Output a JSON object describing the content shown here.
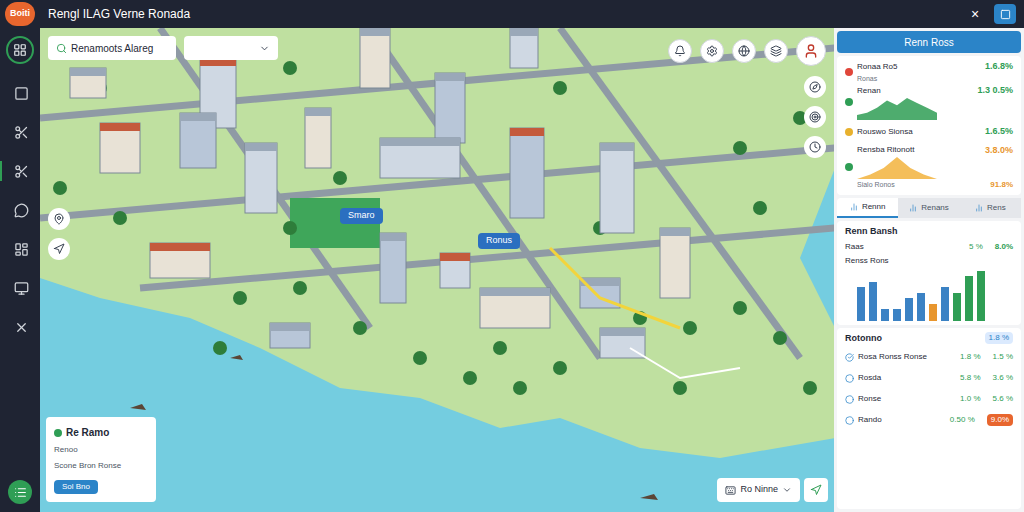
{
  "app": {
    "logo": "Boiti",
    "title": "Rengl ILAG Verne Ronada",
    "close": "×"
  },
  "sidebar": {
    "items": [
      {
        "selected": false
      },
      {
        "selected": false
      },
      {
        "selected": true
      },
      {
        "selected": false
      },
      {
        "selected": false
      },
      {
        "selected": false
      },
      {
        "selected": false
      }
    ]
  },
  "map": {
    "search": "Renamoots Alareg",
    "labels": [
      {
        "text": "Smaro"
      },
      {
        "text": "Ronus"
      }
    ],
    "info_card": {
      "title": "Re Ramo",
      "lines": [
        "Renoo",
        "Scone Bron Ronse"
      ],
      "button": "Sol Bno"
    },
    "toolbar": {
      "label": "Ro Ninne"
    }
  },
  "panel": {
    "header": "Renn Ross",
    "metrics": [
      {
        "name": "Ronaa Ro5",
        "sub": "Ronas",
        "value": "1.6.8%",
        "color": "#e0463a",
        "alert": false
      },
      {
        "name": "Renan",
        "sub": "",
        "value": "1.3 0.5%",
        "color": "#2f9e55",
        "alert": false,
        "chart": {
          "kind": "area",
          "values": [
            2,
            3,
            5,
            8,
            6,
            9,
            7,
            5,
            3
          ]
        }
      },
      {
        "name": "Rouswo Sionsa",
        "sub": "",
        "value": "1.6.5%",
        "color": "#e8b12e",
        "alert": false
      },
      {
        "name": "Rensba Ritonott",
        "sub": "Sialo Ronos",
        "value": "3.8.0%",
        "sub_value": "91.8%",
        "color": "#2f9e55",
        "alert": true,
        "chart": {
          "kind": "peak",
          "values": [
            0,
            2,
            5,
            10,
            5,
            2,
            0
          ]
        }
      }
    ],
    "tabs": [
      {
        "label": "Rennn",
        "selected": true
      },
      {
        "label": "Renans",
        "selected": false
      },
      {
        "label": "Rens",
        "selected": false
      }
    ],
    "section": {
      "title": "Renn Bansh",
      "rows": [
        {
          "label": "Raas",
          "a": "5 %",
          "b": "8.0%"
        }
      ],
      "chart": {
        "title": "Renss Rons",
        "values": [
          6,
          7,
          2,
          2,
          4,
          5,
          3,
          6,
          5,
          8,
          9
        ],
        "colors": [
          "#3b82c4",
          "#3b82c4",
          "#3b82c4",
          "#3b82c4",
          "#3b82c4",
          "#3b82c4",
          "#e8962e",
          "#3b82c4",
          "#2f9e55",
          "#2f9e55",
          "#2f9e55"
        ]
      }
    },
    "list": {
      "title": "Rotonno",
      "badge": "1.8 %",
      "rows": [
        {
          "label": "Rosa Ronss Ronse",
          "a": "1.8 %",
          "b": "1.5 %",
          "highlight": false
        },
        {
          "label": "Rosda",
          "a": "5.8 %",
          "b": "3.6 %",
          "highlight": false
        },
        {
          "label": "Ronse",
          "a": "1.0 %",
          "b": "5.6 %",
          "highlight": false
        },
        {
          "label": "Rando",
          "a": "0.50 %",
          "b": "9.0%",
          "highlight": true
        }
      ]
    }
  }
}
